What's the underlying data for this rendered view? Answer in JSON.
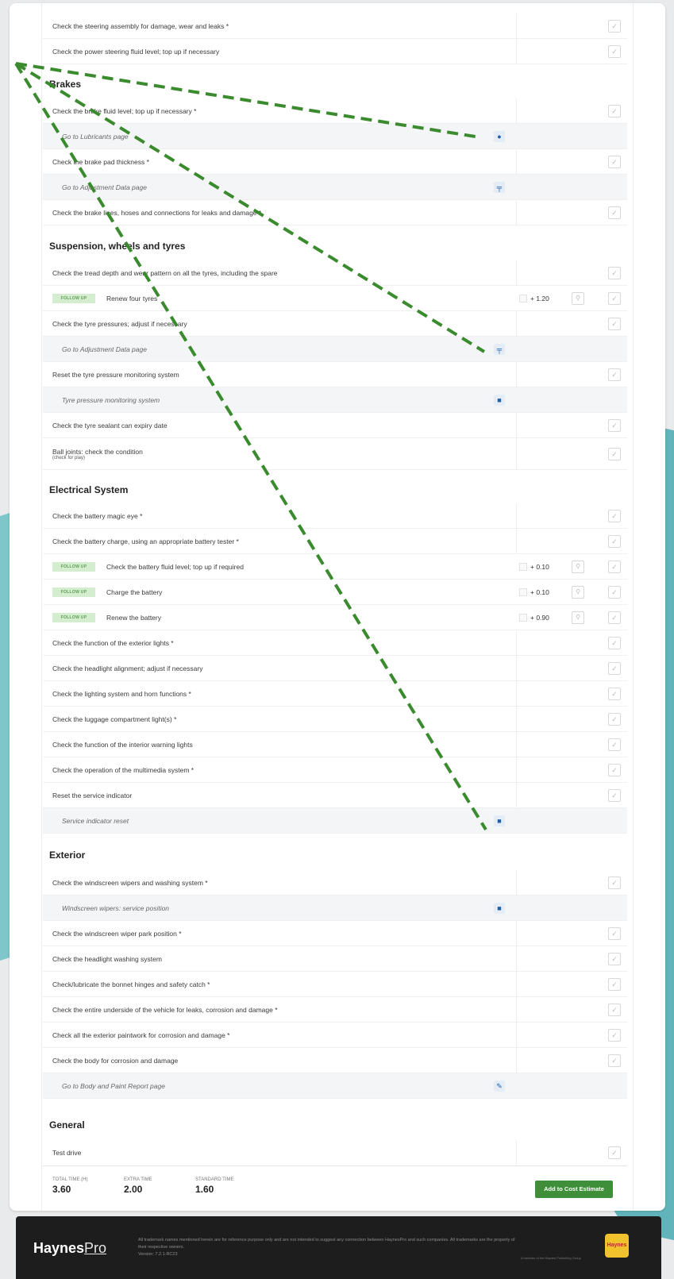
{
  "rows": [
    {
      "label": "Check the steering assembly for damage, wear and leaks  *"
    },
    {
      "label": "Check the power steering fluid level; top up if necessary"
    },
    {
      "label": "Check the brake fluid level; top up if necessary  *"
    },
    {
      "label": "Go to Lubricants page"
    },
    {
      "label": "Check the brake pad thickness  *"
    },
    {
      "label": "Go to Adjustment Data page"
    },
    {
      "label": "Check the brake lines, hoses and connections for leaks and damage  *"
    },
    {
      "label": "Check the tread depth and wear pattern on all the tyres, including the spare"
    },
    {
      "label": "Renew four tyres"
    },
    {
      "label": "Check the tyre pressures; adjust if necessary"
    },
    {
      "label": "Go to Adjustment Data page"
    },
    {
      "label": "Reset the tyre pressure monitoring system"
    },
    {
      "label": "Tyre pressure monitoring system"
    },
    {
      "label": "Check the tyre sealant can expiry date"
    },
    {
      "label": "Ball joints: check the condition",
      "note": "(check for play)"
    },
    {
      "label": "Check the battery magic eye  *"
    },
    {
      "label": "Check the battery charge, using an appropriate battery tester  *"
    },
    {
      "label": "Check the battery fluid level; top up if required"
    },
    {
      "label": "Charge the battery"
    },
    {
      "label": "Renew the battery"
    },
    {
      "label": "Check the function of the exterior lights  *"
    },
    {
      "label": "Check the headlight alignment; adjust if necessary"
    },
    {
      "label": "Check the lighting system and horn functions  *"
    },
    {
      "label": "Check the luggage compartment light(s)  *"
    },
    {
      "label": "Check the function of the interior warning lights"
    },
    {
      "label": "Check the operation of the multimedia system  *"
    },
    {
      "label": "Reset the service indicator"
    },
    {
      "label": "Service indicator reset"
    },
    {
      "label": "Check the windscreen wipers and washing system  *"
    },
    {
      "label": "Windscreen wipers: service position"
    },
    {
      "label": "Check the windscreen wiper park position  *"
    },
    {
      "label": "Check the headlight washing system"
    },
    {
      "label": "Check/lubricate the bonnet hinges and safety catch  *"
    },
    {
      "label": "Check the entire underside of the vehicle for leaks, corrosion and damage  *"
    },
    {
      "label": "Check all the exterior paintwork for corrosion and damage  *"
    },
    {
      "label": "Check the body for corrosion and damage"
    },
    {
      "label": "Go to Body and Paint Report page"
    },
    {
      "label": "Test drive"
    }
  ],
  "sections": {
    "brakes": "Brakes",
    "suspension": "Suspension, wheels and tyres",
    "electrical": "Electrical System",
    "exterior": "Exterior",
    "general": "General"
  },
  "follow_up_label": "FOLLOW UP",
  "follow_up_times": {
    "tyres": "+ 1.20",
    "fluid": "+ 0.10",
    "charge": "+ 0.10",
    "renew": "+ 0.90"
  },
  "totals": {
    "total_label": "TOTAL TIME (H)",
    "total_value": "3.60",
    "extra_label": "EXTRA TIME",
    "extra_value": "2.00",
    "standard_label": "STANDARD TIME",
    "standard_value": "1.60"
  },
  "add_button": "Add to Cost Estimate",
  "footer": {
    "logo_main": "Haynes",
    "logo_pro": "Pro",
    "legal": "All trademark names mentioned herein are for reference purpose only and are not intended to suggest any connection between HaynesPro and such companies. All trademarks are the property of their respective owners.",
    "version": "Version: 7.2.1-RC23",
    "member": "A member of the Haynes Publishing Group",
    "badge": "Haynes"
  },
  "icons": {
    "check": "check-icon",
    "link": "link-icon",
    "wrench": "wrench-icon"
  },
  "colors": {
    "follow_bg": "#d5edcf",
    "follow_text": "#5e9b56",
    "button": "#3f8f3a",
    "arrow": "#3a8a2e"
  }
}
